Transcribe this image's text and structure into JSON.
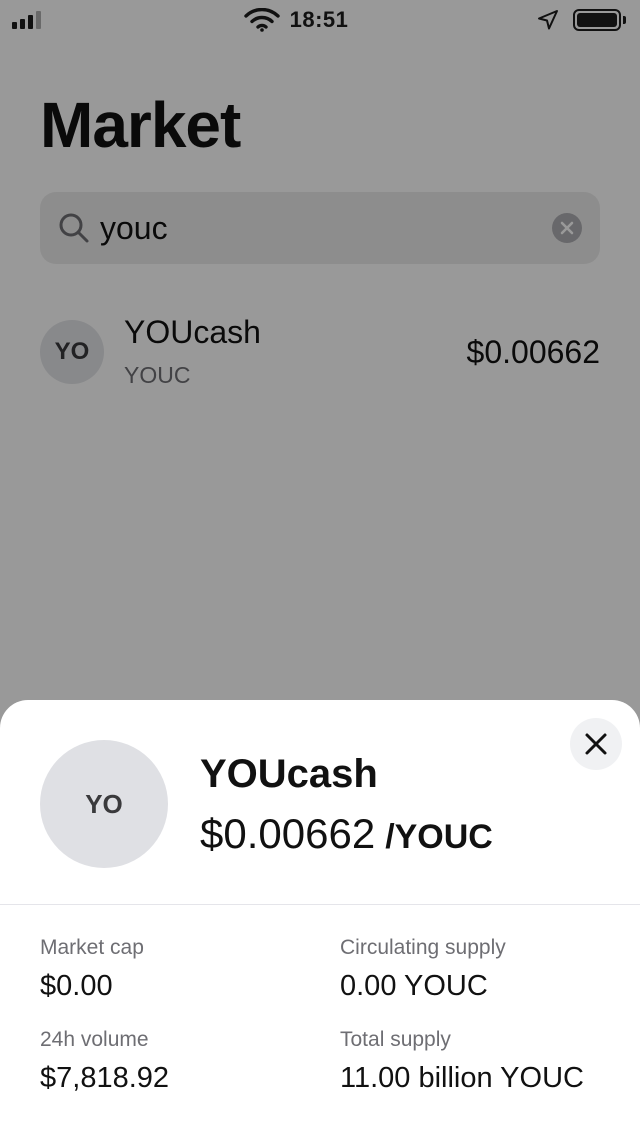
{
  "status_bar": {
    "time": "18:51"
  },
  "page": {
    "title": "Market",
    "search": {
      "value": "youc"
    },
    "results": [
      {
        "avatar": "YO",
        "name": "YOUcash",
        "symbol": "YOUC",
        "price": "$0.00662"
      }
    ]
  },
  "sheet": {
    "avatar": "YO",
    "name": "YOUcash",
    "price": "$0.00662",
    "unit": "/YOUC",
    "stats": {
      "market_cap": {
        "label": "Market cap",
        "value": "$0.00"
      },
      "circulating_supply": {
        "label": "Circulating supply",
        "value": "0.00 YOUC"
      },
      "volume_24h": {
        "label": "24h volume",
        "value": "$7,818.92"
      },
      "total_supply": {
        "label": "Total supply",
        "value": "11.00 billion YOUC"
      }
    }
  },
  "icons": {
    "search": "search-icon",
    "clear": "clear-icon",
    "close": "close-icon",
    "location": "location-arrow-icon",
    "wifi": "wifi-icon",
    "signal": "signal-icon",
    "battery": "battery-icon"
  },
  "colors": {
    "text_primary": "#111111",
    "text_secondary": "#6e6e73",
    "search_bg": "#ececec",
    "avatar_bg": "#dfe0e4",
    "overlay": "rgba(0,0,0,0.4)"
  }
}
